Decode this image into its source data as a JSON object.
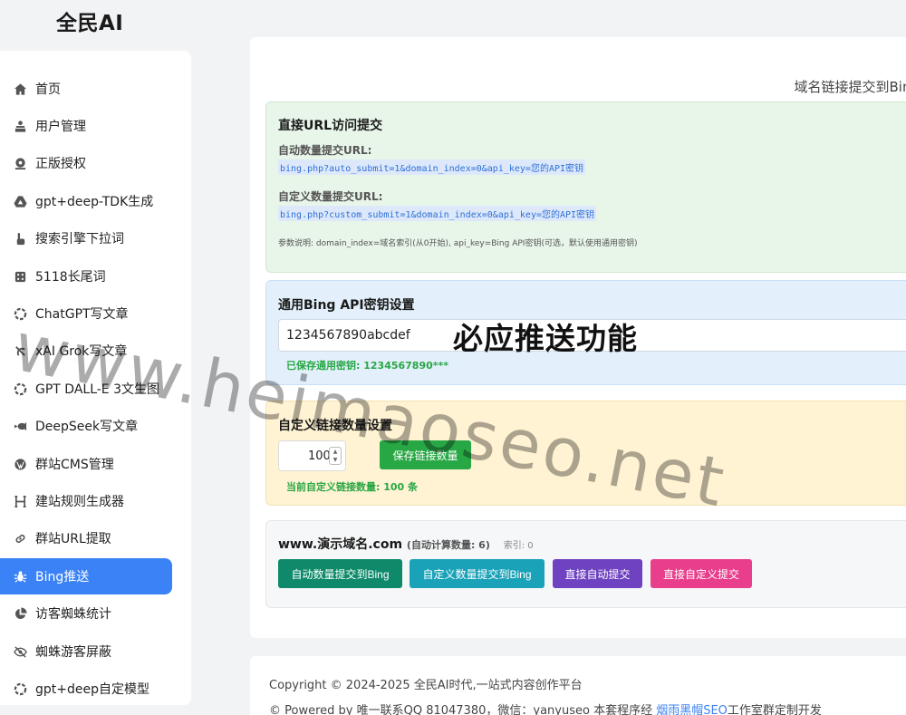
{
  "app": {
    "brand": "全民AI"
  },
  "sidebar": {
    "items": [
      {
        "label": "首页",
        "icon": "home-icon"
      },
      {
        "label": "用户管理",
        "icon": "users-icon"
      },
      {
        "label": "正版授权",
        "icon": "license-icon"
      },
      {
        "label": "gpt+deep-TDK生成",
        "icon": "drive-icon"
      },
      {
        "label": "搜索引擎下拉词",
        "icon": "hand-icon"
      },
      {
        "label": "5118长尾词",
        "icon": "dice-icon"
      },
      {
        "label": "ChatGPT写文章",
        "icon": "openai-icon"
      },
      {
        "label": "xAI Grok写文章",
        "icon": "grok-icon"
      },
      {
        "label": "GPT DALL-E 3文生图",
        "icon": "openai-icon"
      },
      {
        "label": "DeepSeek写文章",
        "icon": "whale-icon"
      },
      {
        "label": "群站CMS管理",
        "icon": "wordpress-icon"
      },
      {
        "label": "建站规则生成器",
        "icon": "h-icon"
      },
      {
        "label": "群站URL提取",
        "icon": "link-icon"
      },
      {
        "label": "Bing推送",
        "icon": "bug-icon",
        "active": true
      },
      {
        "label": "访客蜘蛛统计",
        "icon": "pie-chart-icon"
      },
      {
        "label": "蜘蛛游客屏蔽",
        "icon": "eye-slash-icon"
      },
      {
        "label": "gpt+deep自定模型",
        "icon": "openai-icon"
      }
    ]
  },
  "main": {
    "title": "域名链接提交到Bing",
    "direct": {
      "heading": "直接URL访问提交",
      "auto_label": "自动数量提交URL:",
      "auto_url": "bing.php?auto_submit=1&domain_index=0&api_key=您的API密钥",
      "custom_label": "自定义数量提交URL:",
      "custom_url": "bing.php?custom_submit=1&domain_index=0&api_key=您的API密钥",
      "note": "参数说明: domain_index=域名索引(从0开始), api_key=Bing API密钥(可选，默认使用通用密钥)"
    },
    "api": {
      "heading": "通用Bing API密钥设置",
      "key_value": "1234567890abcdef",
      "saved_text": "已保存通用密钥: 1234567890***"
    },
    "custom": {
      "heading": "自定义链接数量设置",
      "count_value": "100",
      "save_label": "保存链接数量",
      "current_text": "当前自定义链接数量: 100 条"
    },
    "domain": {
      "name": "www.演示域名.com",
      "auto_count": "(自动计算数量: 6)",
      "index": "索引: 0",
      "buttons": [
        "自动数量提交到Bing",
        "自定义数量提交到Bing",
        "直接自动提交",
        "直接自定义提交"
      ]
    }
  },
  "overlay": {
    "title": "必应推送功能",
    "watermark": "www.heimaoseo.net"
  },
  "footer": {
    "copyright": "Copyright © 2024-2025 全民AI时代,一站式内容创作平台",
    "powered_prefix": "© Powered by 唯一联系QQ 81047380，微信：yanyuseo 本套程序经 ",
    "powered_link": "烟雨黑帽SEO",
    "powered_suffix": "工作室群定制开发"
  }
}
